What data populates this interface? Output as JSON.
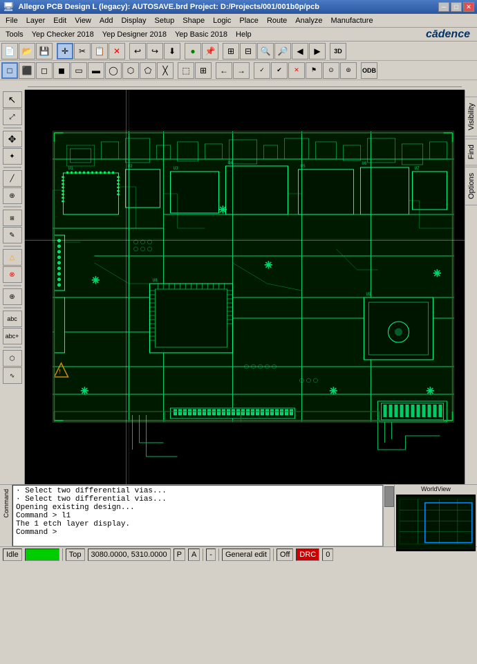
{
  "titleBar": {
    "text": "Allegro PCB Design L (legacy): AUTOSAVE.brd  Project: D:/Projects/001/001b0p/pcb",
    "minBtn": "─",
    "maxBtn": "□",
    "closeBtn": "✕"
  },
  "menuBar1": {
    "items": [
      "File",
      "Layer",
      "Edit",
      "View",
      "Add",
      "Display",
      "Setup",
      "Shape",
      "Logic",
      "Place",
      "Route",
      "Analyze",
      "Manufacture"
    ]
  },
  "menuBar2": {
    "items": [
      "Tools",
      "Yep Checker 2018",
      "Yep Designer 2018",
      "Yep Basic 2018",
      "Help"
    ],
    "logo": "cādence"
  },
  "toolbar1": {
    "buttons": [
      "📂",
      "💾",
      "✂",
      "📋",
      "↩",
      "↪",
      "⬇",
      "●",
      "📌",
      "⊞",
      "⊟",
      "🔍+",
      "🔍-",
      "⬚",
      "3D"
    ]
  },
  "toolbar2": {
    "buttons": [
      "□",
      "⬛",
      "◻",
      "◼",
      "▭",
      "▬",
      "◯",
      "⬡",
      "⬠",
      "╳",
      "⬚",
      "⊞",
      "←",
      "→",
      "ODB"
    ]
  },
  "leftToolbar": {
    "buttons": [
      "↖",
      "⤢",
      "✥",
      "✦",
      "☰",
      "⊕",
      "✎",
      "△",
      "⊗",
      "⊕",
      "abc",
      "abc+"
    ]
  },
  "rightPanel": {
    "tabs": [
      "Visibility",
      "Find",
      "Options"
    ]
  },
  "console": {
    "lines": [
      "· Select two differential vias...",
      "· Select two differential vias...",
      "Opening existing design...",
      "Command > l1",
      "The 1 etch layer display.",
      "Command >"
    ],
    "label": "Command"
  },
  "statusBar": {
    "idle": "Idle",
    "greenIndicator": "",
    "layer": "Top",
    "coordinates": "3080.0000, 5310.0000",
    "p": "P",
    "a": "A",
    "dash": "-",
    "mode": "General edit",
    "off": "Off",
    "drc": "DRC",
    "counter": "0"
  },
  "minimap": {
    "label": "WorldView"
  }
}
